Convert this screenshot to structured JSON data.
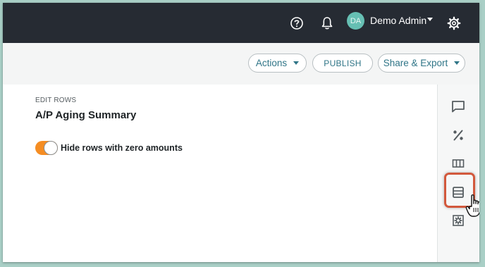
{
  "header": {
    "help_icon": "question-circle-icon",
    "notification_icon": "bell-icon",
    "avatar_initials": "DA",
    "user_name": "Demo Admin",
    "settings_icon": "gear-icon"
  },
  "toolbar": {
    "actions_label": "Actions",
    "publish_label": "PUBLISH",
    "share_label": "Share & Export"
  },
  "panel": {
    "section_label": "EDIT ROWS",
    "title": "A/P Aging Summary",
    "toggle_label": "Hide rows with zero amounts",
    "toggle_on": true
  },
  "right_toolbar": {
    "icons": [
      "comment-icon",
      "percent-icon",
      "columns-icon",
      "rows-icon",
      "settings-icon"
    ],
    "active": "rows-icon"
  },
  "colors": {
    "topbar": "#262b33",
    "accent_teal": "#2f7587",
    "toggle_on": "#f58d23",
    "highlight": "#d2583c",
    "avatar": "#66bfb3"
  }
}
